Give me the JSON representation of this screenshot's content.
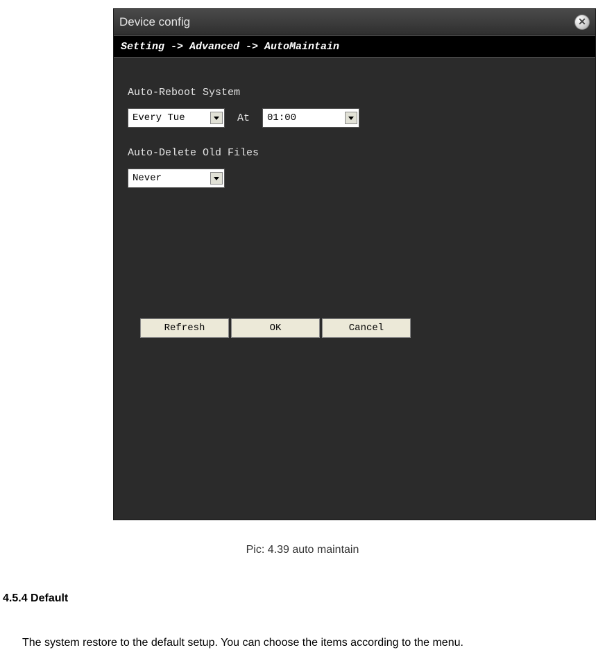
{
  "dialog": {
    "title": "Device config",
    "breadcrumb": "Setting -> Advanced -> AutoMaintain",
    "auto_reboot": {
      "label": "Auto-Reboot System",
      "day_value": "Every Tue",
      "at_label": "At",
      "time_value": "01:00"
    },
    "auto_delete": {
      "label": "Auto-Delete Old Files",
      "value": "Never"
    },
    "buttons": {
      "refresh": "Refresh",
      "ok": "OK",
      "cancel": "Cancel"
    }
  },
  "document": {
    "caption": "Pic: 4.39 auto maintain",
    "section_heading": "4.5.4 Default",
    "body_text": "The system restore to the default setup. You can choose the items according to the menu."
  }
}
